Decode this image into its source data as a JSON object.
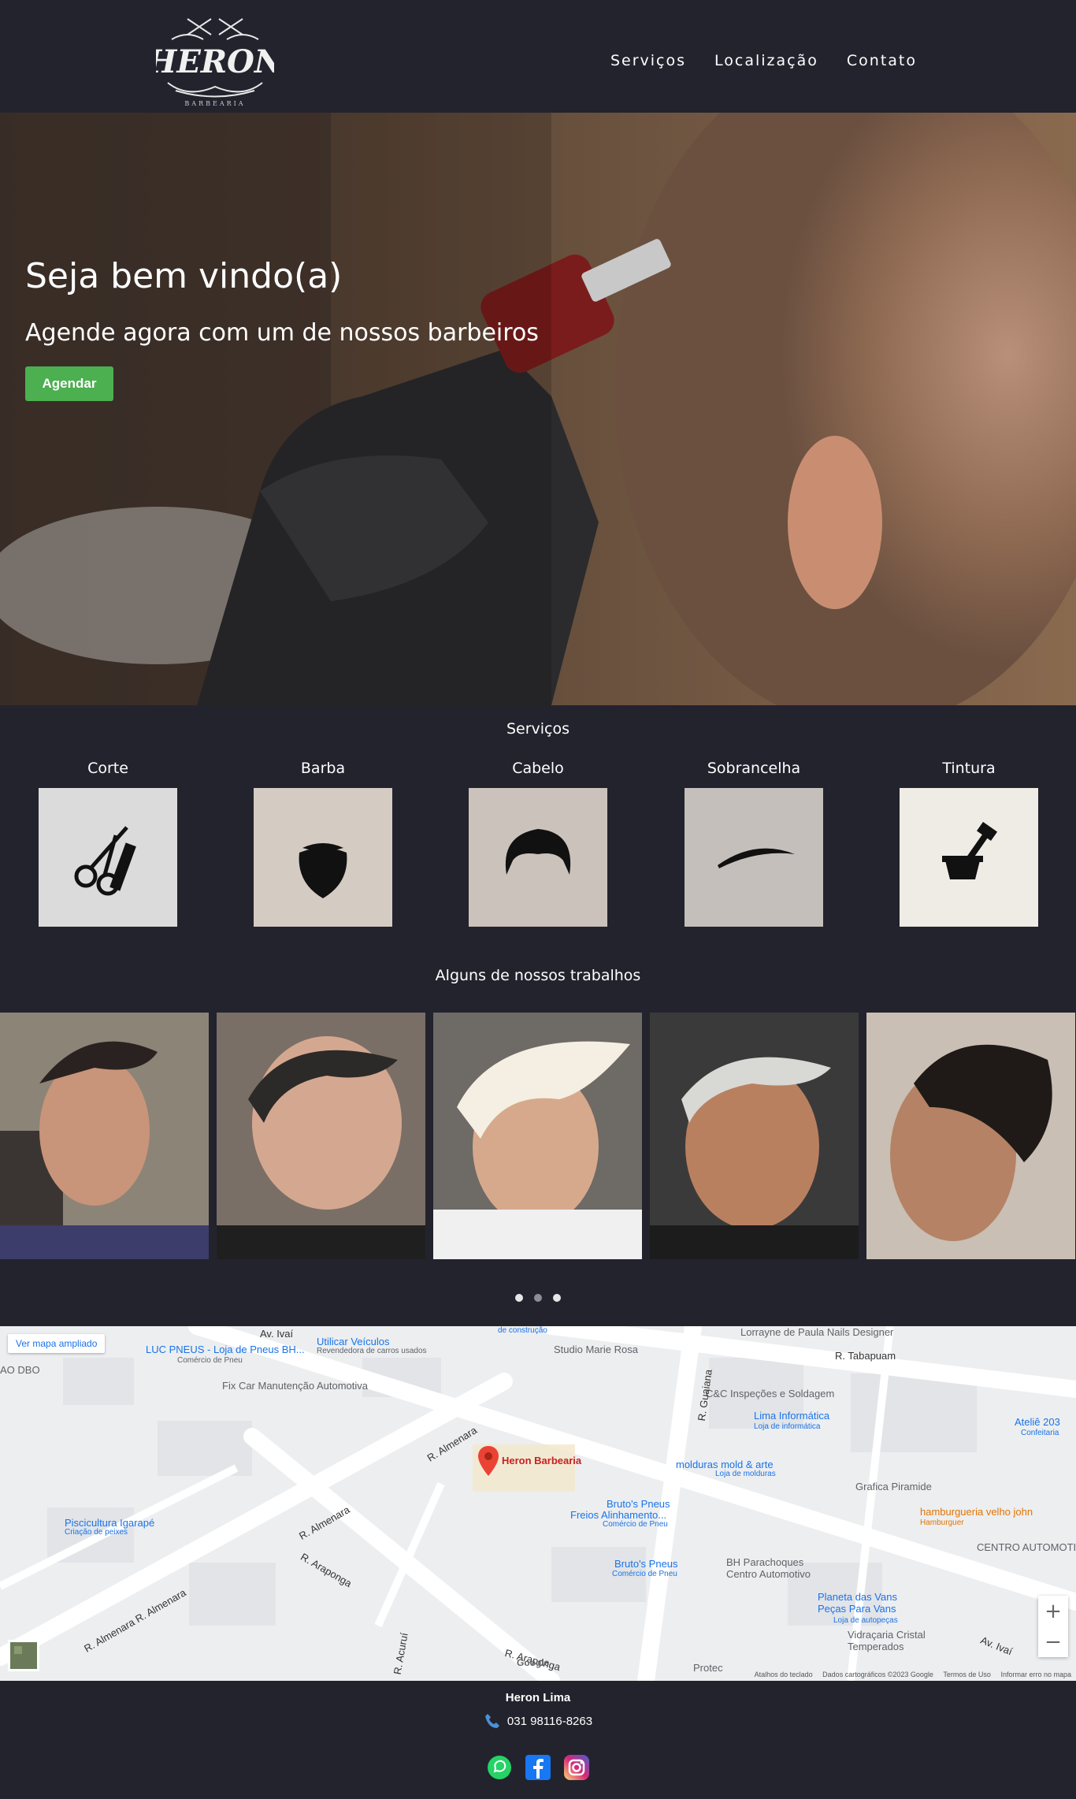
{
  "brand": {
    "logo_text": "HERON",
    "logo_sub": "BARBEARIA"
  },
  "nav": {
    "items": [
      "Serviços",
      "Localização",
      "Contato"
    ]
  },
  "hero": {
    "title": "Seja bem vindo(a)",
    "subtitle": "Agende agora com um de nossos barbeiros",
    "cta": "Agendar"
  },
  "services": {
    "title": "Serviços",
    "items": [
      {
        "label": "Corte",
        "icon": "scissors-comb-icon"
      },
      {
        "label": "Barba",
        "icon": "beard-icon"
      },
      {
        "label": "Cabelo",
        "icon": "hair-icon"
      },
      {
        "label": "Sobrancelha",
        "icon": "eyebrow-icon"
      },
      {
        "label": "Tintura",
        "icon": "hair-dye-icon"
      }
    ]
  },
  "works": {
    "title": "Alguns de nossos trabalhos",
    "active_dot": 1
  },
  "map": {
    "view_larger": "Ver mapa ampliado",
    "pin_label": "Heron Barbearia",
    "labels": [
      "Av. Ivaí",
      "Utilicar Veículos",
      "Revendedora de carros usados",
      "LUC PNEUS - Loja de Pneus BH...",
      "Comércio de Pneu",
      "Fix Car Manutenção Automotiva",
      "AO DBO",
      "de construção",
      "Studio Marie Rosa",
      "Lorrayne de Paula Nails Designer",
      "R. Tabapuam",
      "C&C Inspeções e Soldagem",
      "R. Guaiana",
      "Lima Informática",
      "Loja de informática",
      "Ateliê 203",
      "Confeitaria",
      "molduras mold & arte",
      "Loja de molduras",
      "Grafica Piramide",
      "hamburgueria velho john",
      "Hamburguer",
      "CENTRO AUTOMOTIVO DOM.",
      "Bruto's Pneus",
      "Freios Alinhamento...",
      "Comércio de Pneu",
      "Bruto's Pneus",
      "Comércio de Pneu",
      "BH Parachoques Centro Automotivo",
      "Piscicultura Igarapé",
      "Criação de peixes",
      "R. Almenara",
      "R. Almenara",
      "R. Araponga",
      "R. Almenara R. Almenara",
      "Planeta das Vans Peças Para Vans",
      "Loja de autopeças",
      "Vidraçaria Cristal Temperados",
      "Av. Ivaí",
      "R. Acuruí",
      "R. Araponga",
      "Protec"
    ],
    "attribution": [
      "Atalhos do teclado",
      "Dados cartográficos ©2023 Google",
      "Termos de Uso",
      "Informar erro no mapa"
    ],
    "google": "Google"
  },
  "footer": {
    "name": "Heron Lima",
    "phone": "031 98116-8263",
    "socials": [
      "whatsapp-icon",
      "facebook-icon",
      "instagram-icon"
    ]
  },
  "colors": {
    "background": "#23232e",
    "cta": "#4caf50",
    "link": "#1a73e8",
    "map_pin": "#ea4335"
  }
}
